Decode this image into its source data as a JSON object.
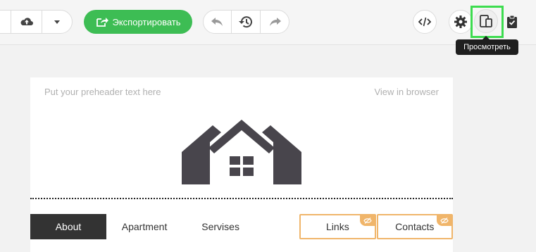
{
  "toolbar": {
    "export_label": "Экспортировать",
    "tooltip": "Просмотреть"
  },
  "email": {
    "preheader": "Put your preheader text here",
    "view_in_browser": "View in browser",
    "menu": [
      {
        "label": "About",
        "state": "active"
      },
      {
        "label": "Apartment",
        "state": "normal"
      },
      {
        "label": "Servises",
        "state": "normal"
      },
      {
        "label": "Links",
        "state": "hidden-on-mobile"
      },
      {
        "label": "Contacts",
        "state": "hidden-on-mobile"
      }
    ]
  },
  "colors": {
    "accent": "#3dbd54",
    "highlight": "#3ddc4f",
    "nav_active": "#333333",
    "hidden_outline": "#f0b56a"
  },
  "icons": [
    "cloud-upload-icon",
    "chevron-down-icon",
    "export-icon",
    "undo-icon",
    "history-icon",
    "redo-icon",
    "code-icon",
    "gear-icon",
    "devices-icon",
    "clipboard-icon",
    "eye-off-icon"
  ]
}
